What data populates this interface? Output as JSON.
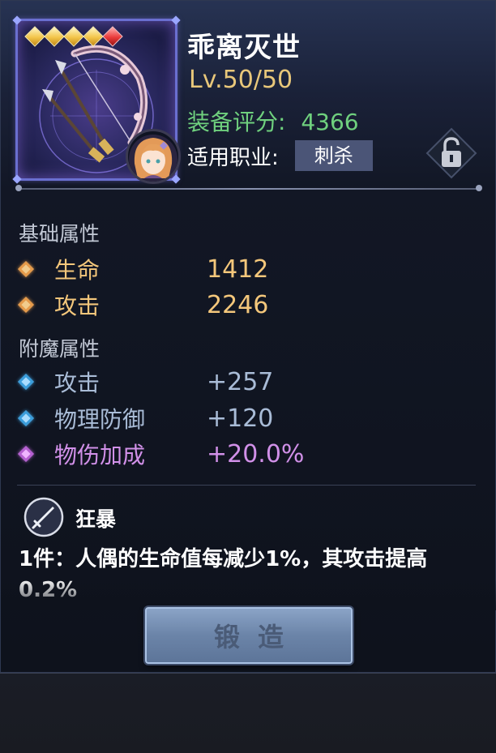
{
  "item": {
    "name": "乖离灭世",
    "level": "Lv.50/50",
    "score_label": "装备评分:",
    "score_value": "4366",
    "class_label": "适用职业:",
    "class_value": "刺杀",
    "stars": {
      "gold": 4,
      "red": 1
    },
    "icon": "crossbow-icon"
  },
  "base_attributes": {
    "title": "基础属性",
    "items": [
      {
        "name": "生命",
        "value": "1412"
      },
      {
        "name": "攻击",
        "value": "2246"
      }
    ]
  },
  "enchant_attributes": {
    "title": "附魔属性",
    "items": [
      {
        "name": "攻击",
        "value": "+257"
      },
      {
        "name": "物理防御",
        "value": "+120"
      },
      {
        "name": "物伤加成",
        "value": "+20.0%"
      }
    ]
  },
  "set_skill": {
    "name": "狂暴",
    "description": "1件：人偶的生命值每减少1%，其攻击提高0.2%",
    "icon": "sword-icon"
  },
  "forge_button": {
    "label": "锻造"
  },
  "colors": {
    "gold_text": "#f4c77b",
    "blue_text": "#a9bcd7",
    "purple_text": "#d190e8",
    "score_green": "#6fd07e",
    "level_gold": "#e8c77a"
  }
}
